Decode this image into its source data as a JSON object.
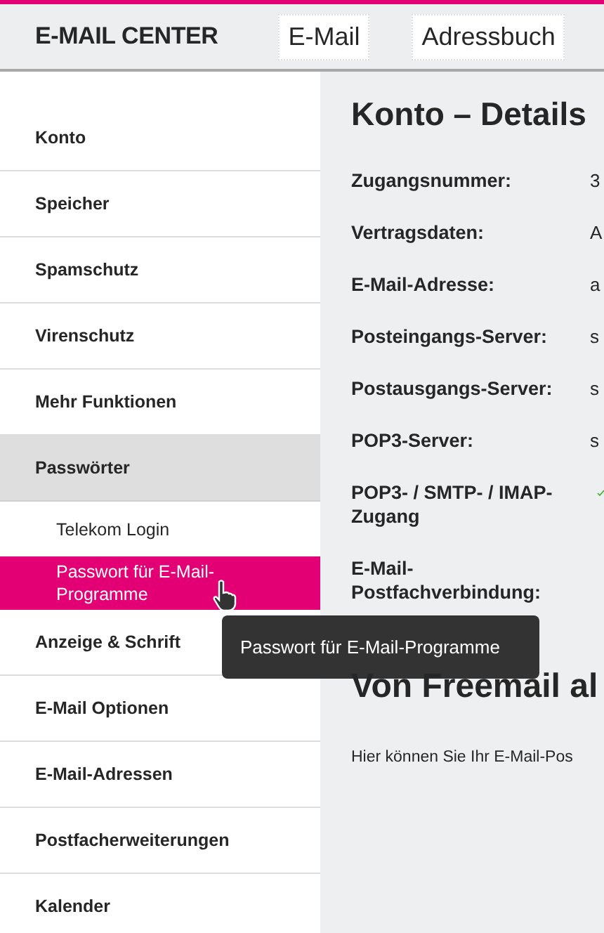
{
  "header": {
    "title": "E-MAIL CENTER",
    "links": [
      "E-Mail",
      "Adressbuch"
    ]
  },
  "sidebar": {
    "items": [
      {
        "label": "Konto",
        "selected": false,
        "expanded": false
      },
      {
        "label": "Speicher",
        "selected": false,
        "expanded": false
      },
      {
        "label": "Spamschutz",
        "selected": false,
        "expanded": false
      },
      {
        "label": "Virenschutz",
        "selected": false,
        "expanded": false
      },
      {
        "label": "Mehr Funktionen",
        "selected": false,
        "expanded": false
      },
      {
        "label": "Passwörter",
        "selected": false,
        "expanded": true,
        "children": [
          {
            "label": "Telekom Login",
            "selected": false
          },
          {
            "label": "Passwort für E-Mail-Programme",
            "selected": true
          }
        ]
      },
      {
        "label": "Anzeige & Schrift",
        "selected": false,
        "expanded": false
      },
      {
        "label": "E-Mail Optionen",
        "selected": false,
        "expanded": false
      },
      {
        "label": "E-Mail-Adressen",
        "selected": false,
        "expanded": false
      },
      {
        "label": "Postfacherweiterungen",
        "selected": false,
        "expanded": false
      },
      {
        "label": "Kalender",
        "selected": false,
        "expanded": false
      }
    ]
  },
  "main": {
    "title": "Konto – Details",
    "details": [
      {
        "label": "Zugangsnummer:",
        "kind": "text",
        "value": "3"
      },
      {
        "label": "Vertragsdaten:",
        "kind": "text",
        "value": "A"
      },
      {
        "label": "E-Mail-Adresse:",
        "kind": "text",
        "value": "a"
      },
      {
        "label": "Posteingangs-Server:",
        "kind": "text",
        "value": "s"
      },
      {
        "label": "Postausgangs-Server:",
        "kind": "text",
        "value": "s"
      },
      {
        "label": "POP3-Server:",
        "kind": "text",
        "value": "s"
      },
      {
        "label": "POP3- / SMTP- / IMAP-Zugang",
        "kind": "check"
      },
      {
        "label": "E-Mail-Postfachverbindung:",
        "kind": "empty"
      }
    ],
    "section_title": "Von Freemail al",
    "section_text": "Hier können Sie Ihr E-Mail-Pos"
  },
  "tooltip": "Passwort für E-Mail-Programme"
}
